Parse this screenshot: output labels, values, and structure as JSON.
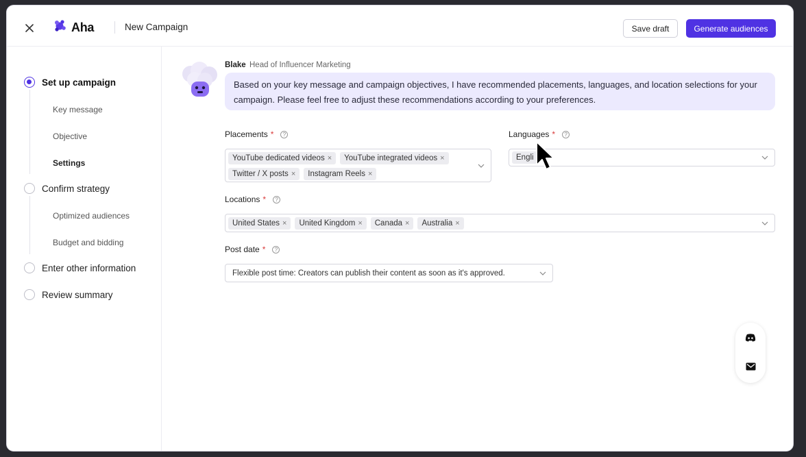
{
  "header": {
    "logo_text": "Aha",
    "page_title": "New Campaign",
    "save_draft_label": "Save draft",
    "generate_label": "Generate audiences"
  },
  "sidebar": {
    "steps": [
      {
        "label": "Set up campaign",
        "state": "active"
      },
      {
        "label": "Confirm strategy",
        "state": "pending"
      },
      {
        "label": "Enter other information",
        "state": "pending"
      },
      {
        "label": "Review summary",
        "state": "pending"
      }
    ],
    "setup_substeps": [
      "Key message",
      "Objective",
      "Settings"
    ],
    "strategy_substeps": [
      "Optimized audiences",
      "Budget and bidding"
    ],
    "current_substep": "Settings"
  },
  "assistant": {
    "name": "Blake",
    "role": "Head of Influencer Marketing",
    "message": "Based on your key message and campaign objectives, I have recommended placements, languages, and location selections for your campaign. Please feel free to adjust these recommendations according to your preferences."
  },
  "form": {
    "placements": {
      "label": "Placements",
      "chips": [
        "YouTube dedicated videos",
        "YouTube integrated videos",
        "Twitter / X posts",
        "Instagram Reels"
      ]
    },
    "languages": {
      "label": "Languages",
      "value": "Engli"
    },
    "locations": {
      "label": "Locations",
      "chips": [
        "United States",
        "United Kingdom",
        "Canada",
        "Australia"
      ]
    },
    "post_date": {
      "label": "Post date",
      "value": "Flexible post time: Creators can publish their content as soon as it's approved."
    },
    "required_mark": "*",
    "help_glyph": "?"
  },
  "icons": {
    "close": "close-icon",
    "logo": "aha-logo-icon",
    "chevron": "chevron-down-icon",
    "chip_remove": "×",
    "discord": "discord-icon",
    "mail": "mail-icon",
    "cursor": "mouse-pointer-icon"
  },
  "colors": {
    "accent": "#4f32e3",
    "bubble": "#eceafe",
    "required": "#d93a3a"
  }
}
